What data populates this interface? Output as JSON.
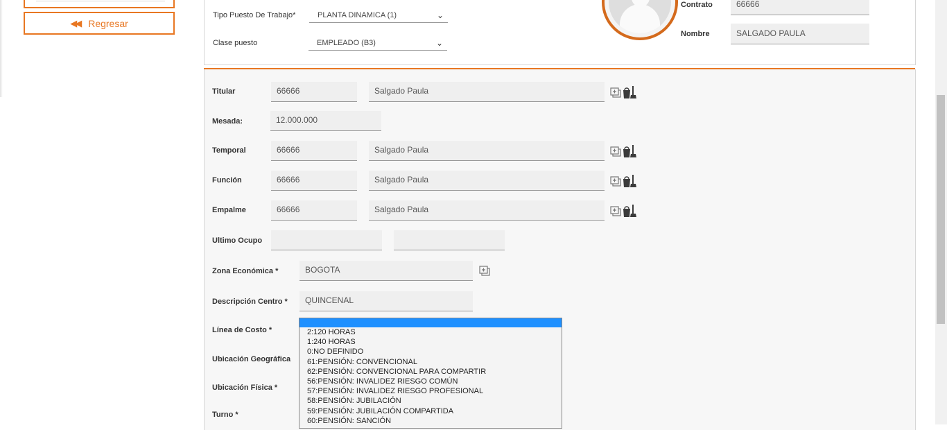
{
  "sidebar": {
    "back_label": "Regresar"
  },
  "header": {
    "tipo_puesto_label": "Tipo Puesto De Trabajo*",
    "tipo_puesto_value": "PLANTA DINAMICA (1)",
    "clase_puesto_label": "Clase puesto",
    "clase_puesto_value": "EMPLEADO (B3)",
    "contrato_label": "Contrato",
    "contrato_value": "66666",
    "nombre_label": "Nombre",
    "nombre_value": "SALGADO PAULA"
  },
  "form": {
    "titular": {
      "label": "Titular",
      "code": "66666",
      "name": "Salgado Paula"
    },
    "mesada": {
      "label": "Mesada:",
      "value": "12.000.000"
    },
    "temporal": {
      "label": "Temporal",
      "code": "66666",
      "name": "Salgado Paula"
    },
    "funcion": {
      "label": "Función",
      "code": "66666",
      "name": "Salgado Paula"
    },
    "empalme": {
      "label": "Empalme",
      "code": "66666",
      "name": "Salgado Paula"
    },
    "ultimo_ocupo": {
      "label": "Ultimo Ocupo",
      "code": "",
      "name": ""
    },
    "zona": {
      "label": "Zona Económica *",
      "value": "BOGOTA"
    },
    "descripcion": {
      "label": "Descripción Centro *",
      "value": "QUINCENAL"
    },
    "linea_costo": {
      "label": "Línea de Costo *"
    },
    "ubic_geo": {
      "label": "Ubicación Geográfica"
    },
    "ubic_fisica": {
      "label": "Ubicación Física *"
    },
    "turno": {
      "label": "Turno *"
    }
  },
  "linea_costo_options": [
    "2:120 HORAS",
    "1:240 HORAS",
    "0:NO DEFINIDO",
    "61:PENSIÓN: CONVENCIONAL",
    "62:PENSIÓN: CONVENCIONAL PARA COMPARTIR",
    "56:PENSIÓN: INVALIDEZ RIESGO COMÚN",
    "57:PENSIÓN: INVALIDEZ RIESGO PROFESIONAL",
    "58:PENSIÓN: JUBILACIÓN",
    "59:PENSIÓN: JUBILACIÓN COMPARTIDA",
    "60:PENSIÓN: SANCIÓN"
  ],
  "colors": {
    "accent": "#e87722",
    "selected": "#1e90ff"
  },
  "icons": {
    "back": "rewind-icon",
    "add": "add-window-icon",
    "clean": "clean-bucket-icon",
    "chevron": "chevron-down-icon"
  }
}
